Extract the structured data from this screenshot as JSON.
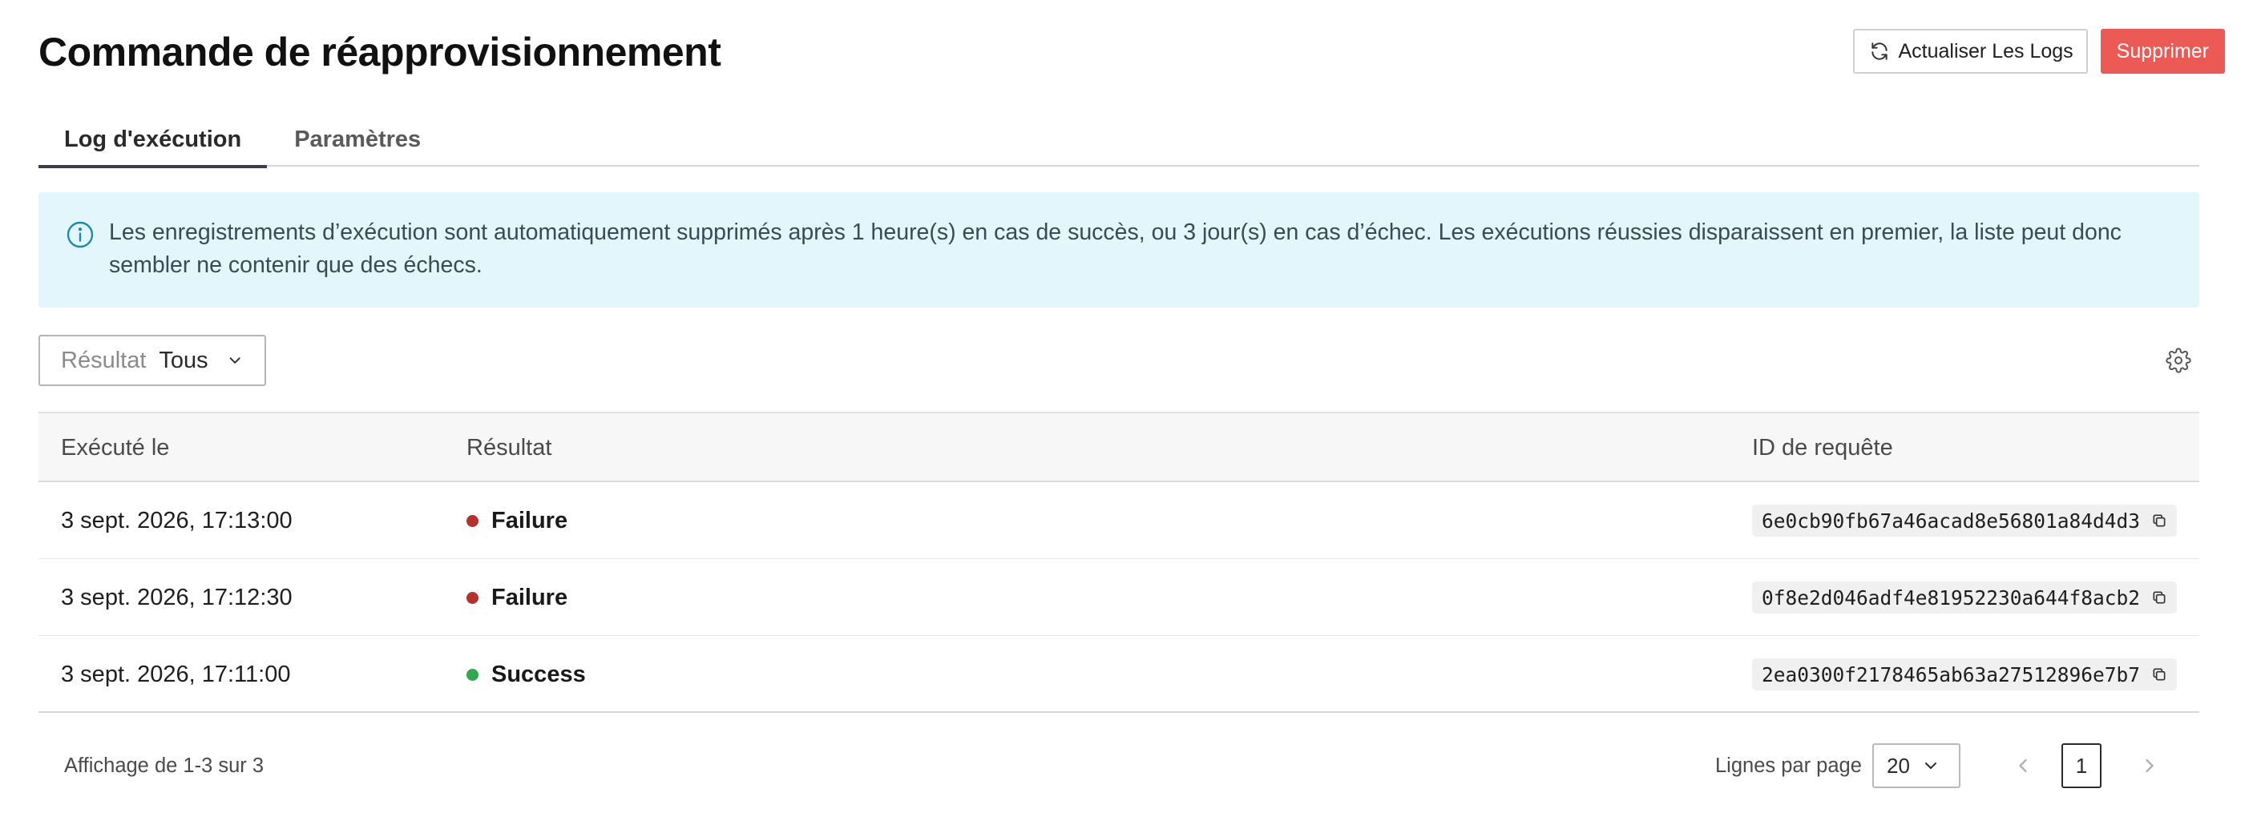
{
  "page": {
    "title": "Commande de réapprovisionnement"
  },
  "header": {
    "refresh_label": "Actualiser Les Logs",
    "delete_label": "Supprimer"
  },
  "tabs": [
    {
      "label": "Log d'exécution",
      "active": true
    },
    {
      "label": "Paramètres",
      "active": false
    }
  ],
  "banner": {
    "text": "Les enregistrements d’exécution sont automatiquement supprimés après 1 heure(s) en cas de succès, ou 3 jour(s) en cas d’échec. Les exécutions réussies disparaissent en premier, la liste peut donc sembler ne contenir que des échecs."
  },
  "filter": {
    "label": "Résultat",
    "value": "Tous"
  },
  "table": {
    "columns": [
      "Exécuté le",
      "Résultat",
      "ID de requête"
    ],
    "rows": [
      {
        "executed_at": "3 sept. 2026, 17:13:00",
        "result": "Failure",
        "result_color": "#b3322c",
        "request_id": "6e0cb90fb67a46acad8e56801a84d4d3"
      },
      {
        "executed_at": "3 sept. 2026, 17:12:30",
        "result": "Failure",
        "result_color": "#b3322c",
        "request_id": "0f8e2d046adf4e81952230a644f8acb2"
      },
      {
        "executed_at": "3 sept. 2026, 17:11:00",
        "result": "Success",
        "result_color": "#2fa84f",
        "request_id": "2ea0300f2178465ab63a27512896e7b7"
      }
    ]
  },
  "footer": {
    "summary": "Affichage de 1-3 sur 3",
    "rows_per_page_label": "Lignes par page",
    "rows_per_page_value": "20",
    "current_page": "1"
  },
  "colors": {
    "danger": "#eb5a55",
    "info_background": "#e2f6fc",
    "info_icon": "#1f8aa8",
    "failure": "#b3322c",
    "success": "#2fa84f"
  }
}
